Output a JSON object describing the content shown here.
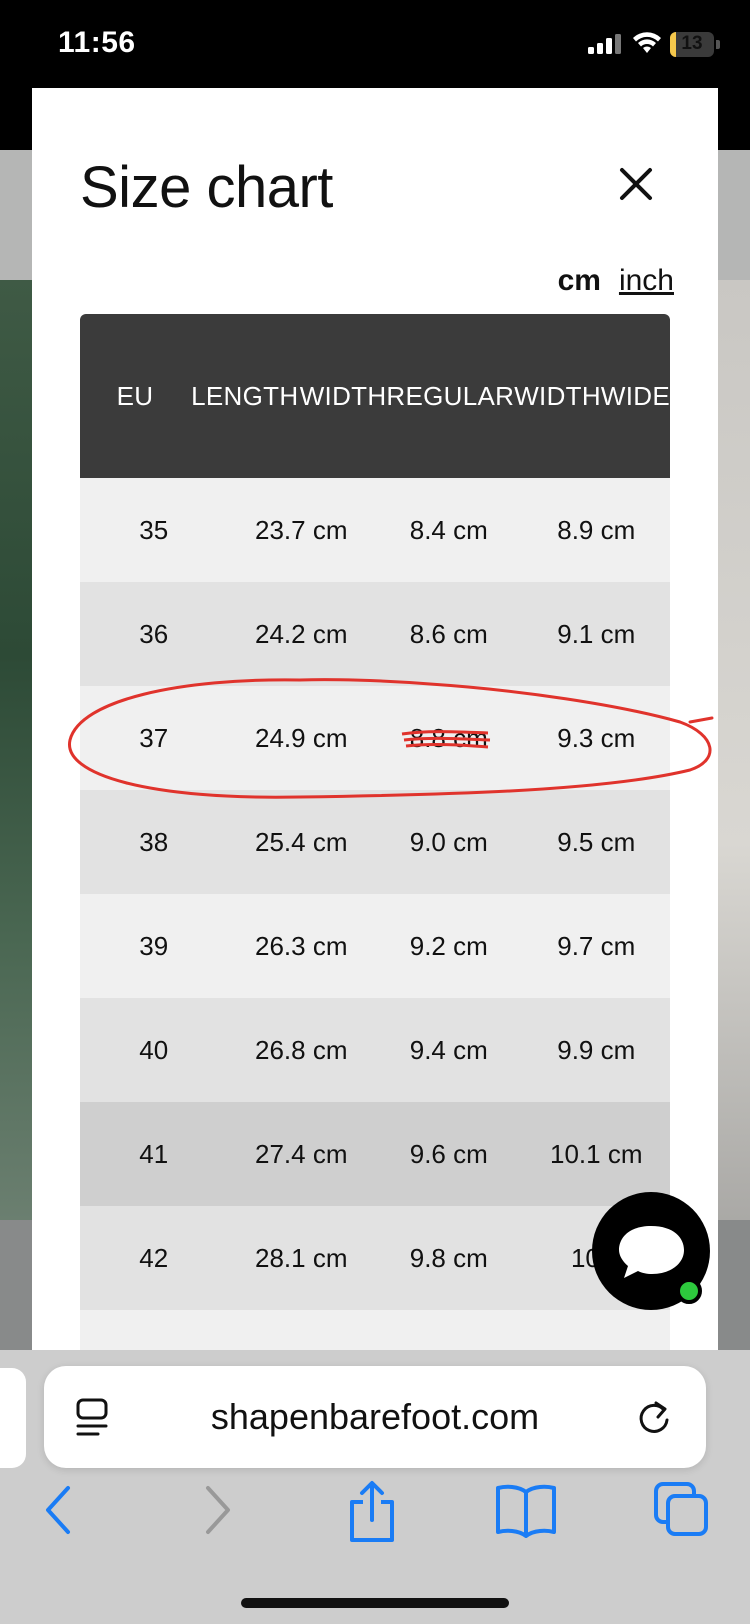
{
  "status_bar": {
    "time": "11:56",
    "battery": "13",
    "battery_level": 0.13
  },
  "modal": {
    "title": "Size chart",
    "units": {
      "cm": "cm",
      "inch": "inch"
    },
    "headers": [
      [
        "EU"
      ],
      [
        "LENGTH"
      ],
      [
        "WIDTH",
        "REGULAR"
      ],
      [
        "WIDTH",
        "WIDE"
      ]
    ],
    "rows": [
      [
        "35",
        "23.7 cm",
        "8.4 cm",
        "8.9 cm"
      ],
      [
        "36",
        "24.2 cm",
        "8.6 cm",
        "9.1 cm"
      ],
      [
        "37",
        "24.9 cm",
        "8.8 cm",
        "9.3 cm"
      ],
      [
        "38",
        "25.4 cm",
        "9.0 cm",
        "9.5 cm"
      ],
      [
        "39",
        "26.3 cm",
        "9.2 cm",
        "9.7 cm"
      ],
      [
        "40",
        "26.8 cm",
        "9.4 cm",
        "9.9 cm"
      ],
      [
        "41",
        "27.4 cm",
        "9.6 cm",
        "10.1 cm"
      ],
      [
        "42",
        "28.1 cm",
        "9.8 cm",
        "10.3"
      ]
    ]
  },
  "browser": {
    "address": "shapenbarefoot.com"
  },
  "colors": {
    "header_bg": "#3b3b3b",
    "annotation": "#e0332c",
    "chat_online": "#2dc93d",
    "ios_blue": "#1a7cf5"
  }
}
